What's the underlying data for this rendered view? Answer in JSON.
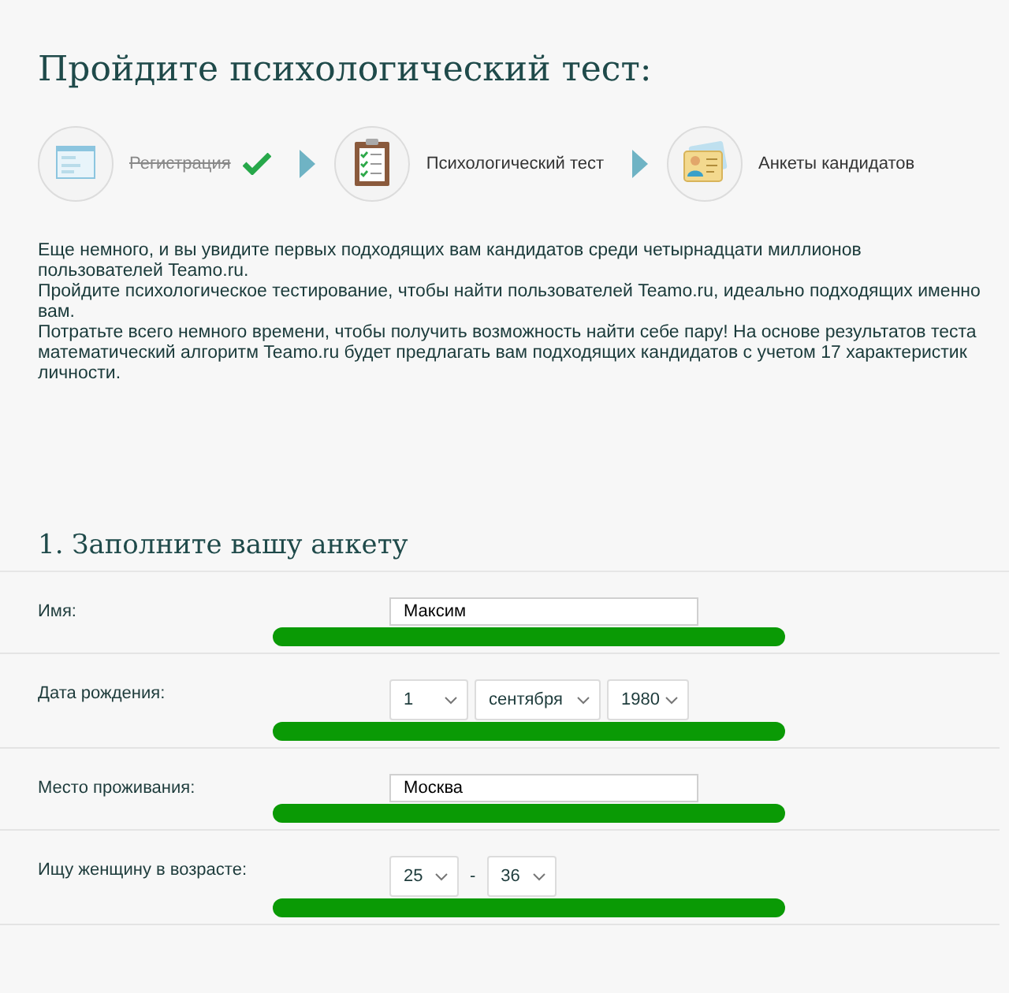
{
  "title": "Пройдите психологический тест:",
  "steps": [
    {
      "label": "Регистрация",
      "completed": true,
      "kind": "form"
    },
    {
      "label": "Психологический тест",
      "completed": false,
      "kind": "clipboard"
    },
    {
      "label": "Анкеты кандидатов",
      "completed": false,
      "kind": "profiles"
    }
  ],
  "intro": [
    "Еще немного, и вы увидите первых подходящих вам кандидатов среди четырнадцати миллионов пользователей Teamo.ru.",
    "Пройдите психологическое тестирование, чтобы найти пользователей Teamo.ru, идеально подходящих именно вам.",
    "Потратьте всего немного времени, чтобы получить возможность найти себе пару! На основе результатов теста математический алгоритм Teamo.ru будет предлагать вам подходящих кандидатов с учетом 17 характеристик личности."
  ],
  "section_title": "1. Заполните вашу анкету",
  "fields": [
    {
      "label": "Имя:",
      "kind": "text",
      "value": "Максим"
    },
    {
      "label": "Дата рождения:",
      "kind": "selects",
      "selects": [
        "1",
        "сентября",
        "1980"
      ]
    },
    {
      "label": "Место проживания:",
      "kind": "text",
      "value": "Москва"
    },
    {
      "label": "Ищу женщину в возрасте:",
      "kind": "range",
      "selects": [
        "25",
        "36"
      ],
      "separator": "-"
    }
  ]
}
